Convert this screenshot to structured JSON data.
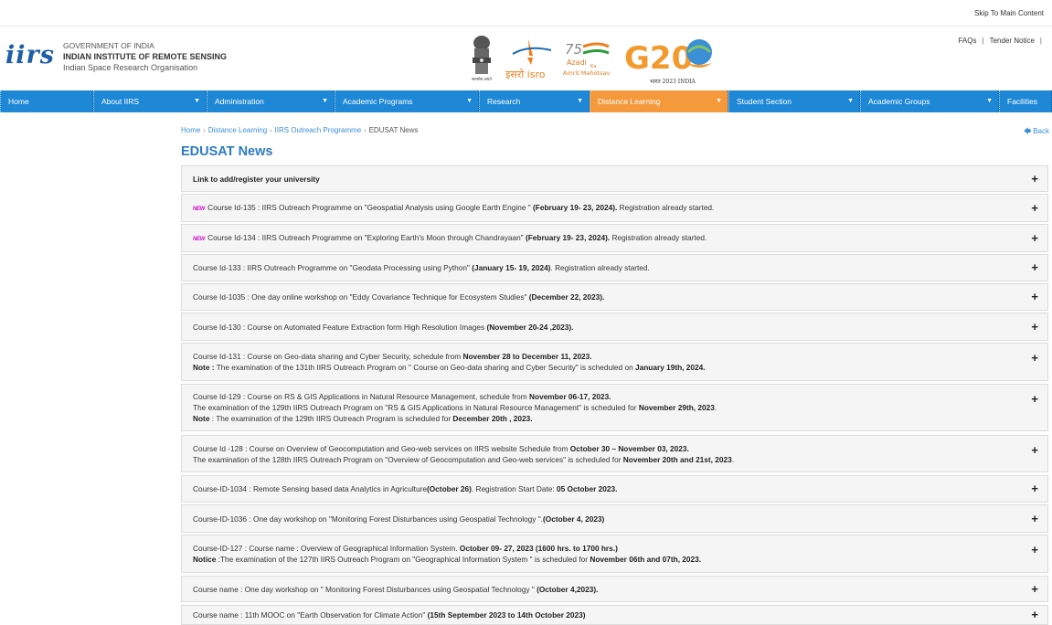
{
  "header": {
    "skip_link": "Skip To Main Content",
    "logo_text": "iirs",
    "org_line1": "GOVERNMENT OF INDIA",
    "org_line2": "INDIAN INSTITUTE OF REMOTE SENSING",
    "org_line3": "Indian Space Research Organisation",
    "emblem_caption": "सत्यमेव जयते",
    "isro_text": "इसरो isro",
    "azadi_text": [
      "Azadi",
      "Ka",
      "Amrit Mahotsav"
    ],
    "g20_text": "G20",
    "g20_caption": "भारत 2023 INDIA",
    "links": [
      "FAQs",
      "Tender Notice"
    ]
  },
  "nav": {
    "items": [
      {
        "label": "Home",
        "caret": false,
        "active": false
      },
      {
        "label": "About IIRS",
        "caret": true,
        "active": false
      },
      {
        "label": "Administration",
        "caret": true,
        "active": false
      },
      {
        "label": "Academic Programs",
        "caret": true,
        "active": false
      },
      {
        "label": "Research",
        "caret": true,
        "active": false
      },
      {
        "label": "Distance Learning",
        "caret": true,
        "active": true
      },
      {
        "label": "Student Section",
        "caret": true,
        "active": false
      },
      {
        "label": "Academic Groups",
        "caret": true,
        "active": false
      },
      {
        "label": "Facilities",
        "caret": false,
        "active": false
      }
    ]
  },
  "breadcrumb": [
    "Home",
    "Distance Learning",
    "IIRS Outreach Programme",
    "EDUSAT News"
  ],
  "back_label": "Back",
  "page_title": "EDUSAT News",
  "rows": [
    {
      "lines": [
        [
          {
            "t": "Link to add/register your university",
            "b": true
          }
        ]
      ]
    },
    {
      "new": true,
      "lines": [
        [
          {
            "t": "Course Id-135 : IIRS Outreach Programme on \"Geospatial Analysis using Google Earth Engine \" "
          },
          {
            "t": "(February 19- 23, 2024).",
            "b": true
          },
          {
            "t": " Registration already started."
          }
        ]
      ]
    },
    {
      "new": true,
      "lines": [
        [
          {
            "t": "Course Id-134 : IIRS Outreach Programme on \"Exploring Earth's Moon through Chandrayaan\" "
          },
          {
            "t": "(February 19- 23, 2024).",
            "b": true
          },
          {
            "t": " Registration already started."
          }
        ]
      ]
    },
    {
      "lines": [
        [
          {
            "t": "Course Id-133 : IIRS Outreach Programme on \"Geodata Processing using Python\" "
          },
          {
            "t": "(January 15- 19, 2024)",
            "b": true
          },
          {
            "t": ". Registration already started."
          }
        ]
      ]
    },
    {
      "lines": [
        [
          {
            "t": "Course Id-1035 : One day online workshop on \"Eddy Covariance Technique for Ecosystem Studies\" "
          },
          {
            "t": "(December 22, 2023).",
            "b": true
          }
        ]
      ]
    },
    {
      "lines": [
        [
          {
            "t": "Course Id-130 : Course on Automated Feature Extraction form High Resolution Images "
          },
          {
            "t": "(November 20-24 ,2023).",
            "b": true
          }
        ]
      ]
    },
    {
      "lines": [
        [
          {
            "t": "Course Id-131 : Course on Geo-data sharing and Cyber Security, schedule from "
          },
          {
            "t": "November 28 to December 11, 2023.",
            "b": true
          }
        ],
        [
          {
            "t": "Note :",
            "b": true
          },
          {
            "t": " The examination of the 131th IIRS Outreach Program on \" Course on Geo-data sharing and Cyber Security\" is scheduled on "
          },
          {
            "t": "January 19th, 2024.",
            "b": true
          }
        ]
      ]
    },
    {
      "lines": [
        [
          {
            "t": "Course Id-129 : Course on RS & GIS Applications in Natural Resource Management, schedule from "
          },
          {
            "t": "November 06-17, 2023.",
            "b": true
          }
        ],
        [
          {
            "t": "The examination of the 129th IIRS Outreach Program on \"RS & GIS Applications in Natural Resource Management\" is scheduled for "
          },
          {
            "t": "November 29th, 2023",
            "b": true
          },
          {
            "t": "."
          }
        ],
        [
          {
            "t": "Note",
            "b": true
          },
          {
            "t": " : The examination of the 129th IIRS Outreach Program is scheduled for "
          },
          {
            "t": "December 20th , 2023.",
            "b": true
          }
        ]
      ]
    },
    {
      "lines": [
        [
          {
            "t": "Course Id -128 : Course on Overview of Geocomputation and Geo-web services on IIRS website Schedule from "
          },
          {
            "t": "October 30 – November 03, 2023.",
            "b": true
          }
        ],
        [
          {
            "t": "The examination of the 128th IIRS Outreach Program on \"Overview of Geocomputation and Geo-web services\" is scheduled for "
          },
          {
            "t": "November 20th and 21st, 2023",
            "b": true
          },
          {
            "t": "."
          }
        ]
      ]
    },
    {
      "lines": [
        [
          {
            "t": "Course-ID-1034 : Remote Sensing based data Analytics in Agriculture"
          },
          {
            "t": "(October 26)",
            "b": true
          },
          {
            "t": ". Registration Start Date: "
          },
          {
            "t": "05 October 2023.",
            "b": true
          }
        ]
      ]
    },
    {
      "lines": [
        [
          {
            "t": "Course-ID-1036 : One day workshop on \"Monitoring Forest Disturbances using Geospatial Technology \"."
          },
          {
            "t": "(October 4, 2023)",
            "b": true
          }
        ]
      ]
    },
    {
      "lines": [
        [
          {
            "t": "Course-ID-127 : Course name : Overview of Geographical Information System. "
          },
          {
            "t": "October 09- 27, 2023 (1600 hrs. to 1700 hrs.)",
            "b": true
          }
        ],
        [
          {
            "t": "Notice",
            "b": true
          },
          {
            "t": " :The examination of the 127th IIRS Outreach Program on \"Geographical Information System \" is scheduled for "
          },
          {
            "t": "November 06th and 07th, 2023.",
            "b": true
          }
        ]
      ]
    },
    {
      "lines": [
        [
          {
            "t": "Course name : One day workshop on \" Monitoring Forest Disturbances using Geospatial Technology \" "
          },
          {
            "t": "(October 4,2023).",
            "b": true
          }
        ]
      ]
    },
    {
      "lines": [
        [
          {
            "t": "Course name : 11th MOOC on \"Earth Observation for Climate Action\" "
          },
          {
            "t": "(15th September 2023 to 14th October 2023)",
            "b": true
          }
        ]
      ]
    }
  ],
  "colors": {
    "nav_bg": "#1e88d6",
    "nav_active": "#f49a3c",
    "title": "#2c7cc2",
    "new_badge": "#d10ccf"
  }
}
